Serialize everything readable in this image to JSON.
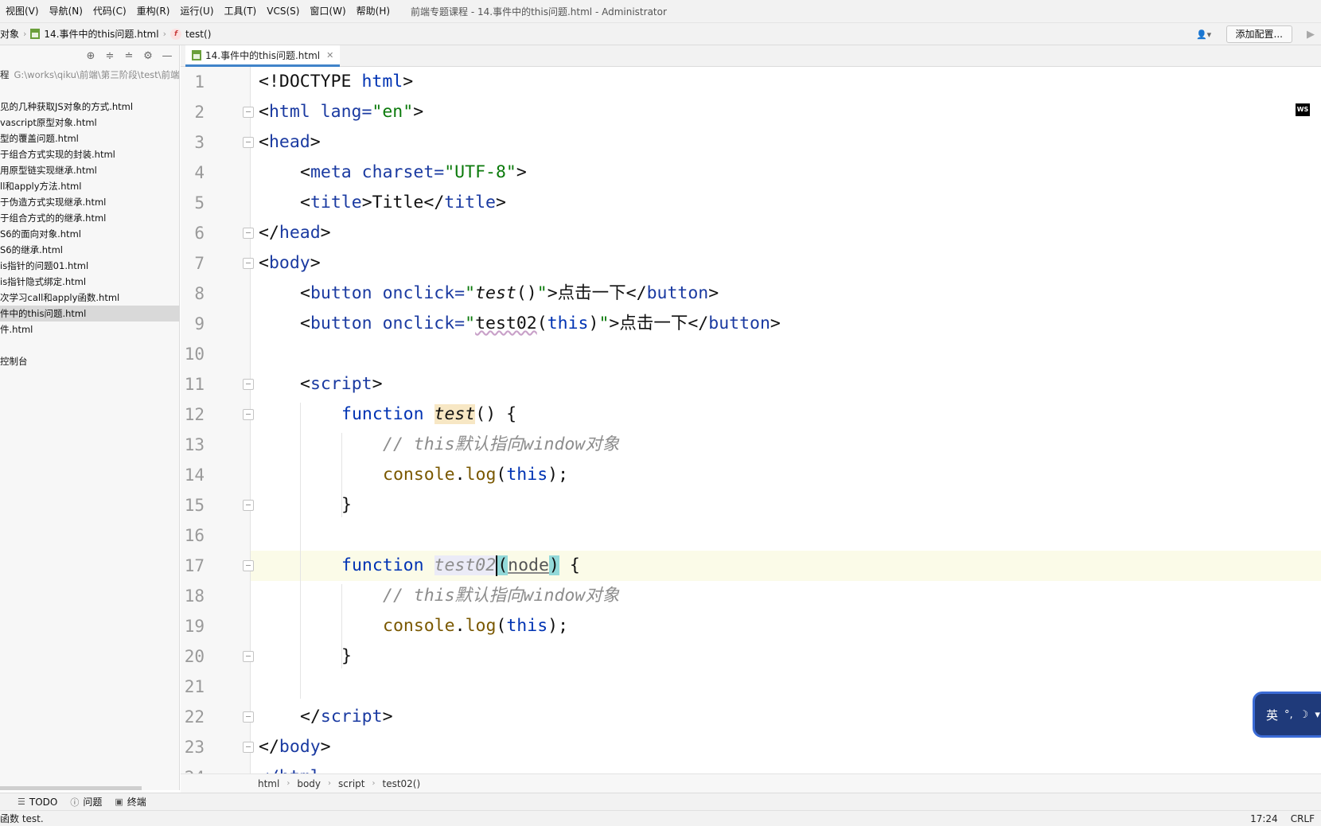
{
  "menu": {
    "items": [
      "视图(V)",
      "导航(N)",
      "代码(C)",
      "重构(R)",
      "运行(U)",
      "工具(T)",
      "VCS(S)",
      "窗口(W)",
      "帮助(H)"
    ],
    "window_title": "前端专题课程 - 14.事件中的this问题.html - Administrator"
  },
  "navbar": {
    "crumb_root": "对象",
    "crumb_file": "14.事件中的this问题.html",
    "crumb_func": "test()",
    "config_button": "添加配置..."
  },
  "project": {
    "root_label": "程",
    "root_path": "G:\\works\\qiku\\前端\\第三阶段\\test\\前端",
    "items": [
      "",
      "见的几种获取JS对象的方式.html",
      "vascript原型对象.html",
      "型的覆盖问题.html",
      "于组合方式实现的封装.html",
      "用原型链实现继承.html",
      "ll和apply方法.html",
      "于伪造方式实现继承.html",
      "于组合方式的的继承.html",
      "S6的面向对象.html",
      "S6的继承.html",
      "is指针的问题01.html",
      "is指针隐式绑定.html",
      "次学习call和apply函数.html",
      "件中的this问题.html",
      "件.html",
      "",
      "控制台"
    ],
    "selected_index": 14
  },
  "tab": {
    "label": "14.事件中的this问题.html"
  },
  "editor": {
    "line_numbers": [
      "1",
      "2",
      "3",
      "4",
      "5",
      "6",
      "7",
      "8",
      "9",
      "10",
      "11",
      "12",
      "13",
      "14",
      "15",
      "16",
      "17",
      "18",
      "19",
      "20",
      "21",
      "22",
      "23",
      "24"
    ],
    "tokens": {
      "doctype_open": "<!DOCTYPE ",
      "doctype_kw": "html",
      "doctype_close": ">",
      "html_lt": "<",
      "html_tag": "html",
      "html_attr": " lang=",
      "html_val": "\"en\"",
      "gt": ">",
      "head_tag": "head",
      "meta_tag": "meta",
      "meta_attr": " charset=",
      "meta_val": "\"UTF-8\"",
      "title_tag": "title",
      "title_text": "Title",
      "title_close": "</",
      "head_close": "head",
      "body_tag": "body",
      "button_tag": "button",
      "onclick_attr": " onclick=",
      "quote": "\"",
      "test_call": "test",
      "parens": "()",
      "click_text": "点击一下",
      "button_close": "button",
      "test02_call": "test02",
      "this_arg": "(this)",
      "script_tag": "script",
      "function_kw": "function",
      "test_name": "test",
      "open_brace": " {",
      "comment": "// this默认指向window对象",
      "console": "console",
      "dot": ".",
      "log": "log",
      "lparen": "(",
      "this_kw": "this",
      "rparen_semi": ");",
      "close_brace": "}",
      "test02_name": "test02",
      "paren_open": "(",
      "param": "node",
      "paren_close": ")",
      "script_close": "script",
      "body_close": "body",
      "html_close_partial": "</html"
    }
  },
  "editor_breadcrumbs": [
    "html",
    "body",
    "script",
    "test02()"
  ],
  "tool_windows": [
    "TODO",
    "问题",
    "终端"
  ],
  "status": {
    "message": "函数 test.",
    "position": "17:24",
    "line_ending": "CRLF"
  },
  "ime": {
    "label": "英"
  },
  "colors": {
    "accent": "#4083c9",
    "keyword": "#0033b3",
    "string": "#0b7a0b",
    "comment": "#8c8c8c"
  }
}
